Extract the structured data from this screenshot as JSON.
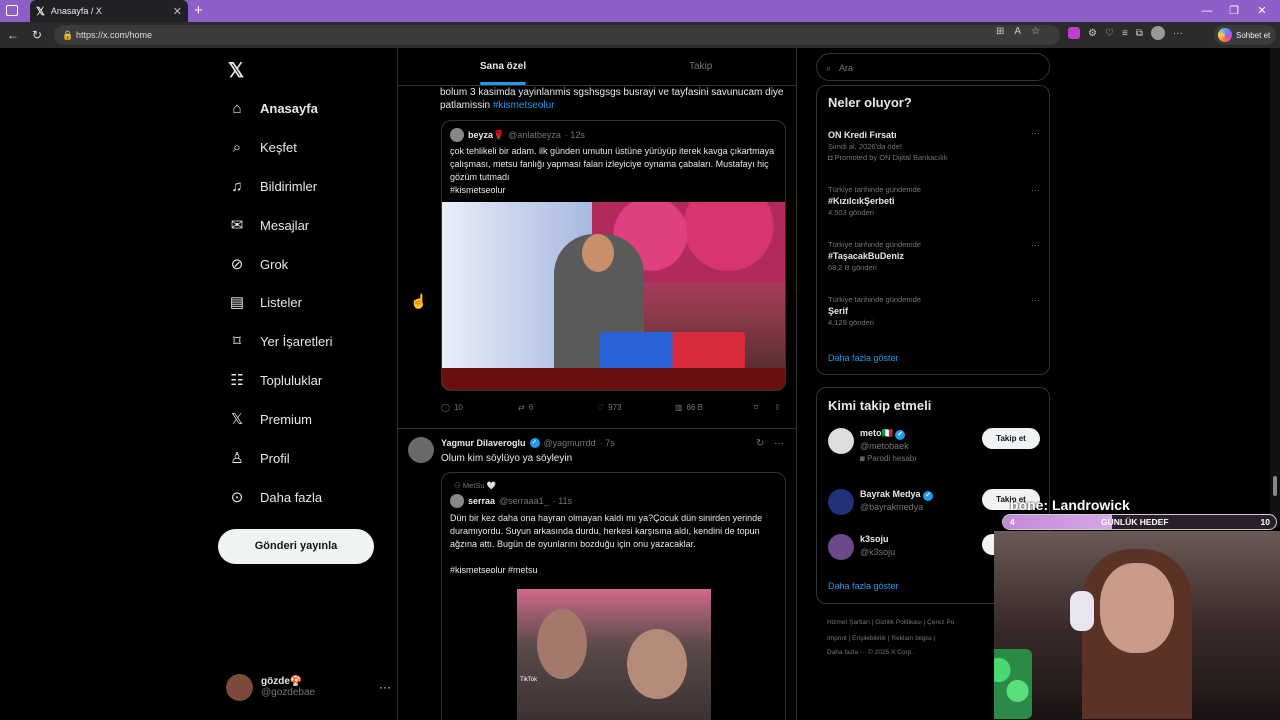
{
  "browser": {
    "tab_title": "Anasayfa / X",
    "url": "https://x.com/home",
    "copilot_label": "Sohbet et"
  },
  "sidebar": {
    "items": [
      {
        "label": "Anasayfa",
        "icon": "home-icon"
      },
      {
        "label": "Keşfet",
        "icon": "search-icon"
      },
      {
        "label": "Bildirimler",
        "icon": "bell-icon"
      },
      {
        "label": "Mesajlar",
        "icon": "mail-icon"
      },
      {
        "label": "Grok",
        "icon": "grok-icon"
      },
      {
        "label": "Listeler",
        "icon": "list-icon"
      },
      {
        "label": "Yer İşaretleri",
        "icon": "bookmark-icon"
      },
      {
        "label": "Topluluklar",
        "icon": "communities-icon"
      },
      {
        "label": "Premium",
        "icon": "x-icon"
      },
      {
        "label": "Profil",
        "icon": "person-icon"
      },
      {
        "label": "Daha fazla",
        "icon": "more-circle-icon"
      }
    ],
    "post_button": "Gönderi yayınla",
    "account": {
      "name": "gözde🍄",
      "handle": "@gozdebae"
    }
  },
  "feed": {
    "tabs": [
      "Sana özel",
      "Takip"
    ],
    "tweet1": {
      "text": "bolum 3 kasimda yayinlanmis sgshsgsgs busrayi ve tayfasini savunucam diye patlamissin",
      "hashtag": "#kismetseolur",
      "quote": {
        "name": "beyza🌹",
        "handle": "@anlatbeyza",
        "time": "· 12s",
        "text": "çok tehlikeli bir adam. ilk günden umutun üstüne yürüyüp iterek kavga çıkartmaya çalışması, metsu fanlığı yapması falan izleyiciye oynama çabaları. Mustafayı hiç gözüm tutmadı",
        "hashtag": "#kismetseolur"
      },
      "stats": {
        "replies": "10",
        "retweets": "6",
        "likes": "973",
        "views": "66 B"
      }
    },
    "tweet2": {
      "name": "Yagmur Dilaveroglu",
      "handle": "@yagmurrdd",
      "time": "· 7s",
      "text": "Olum kim söylüyo ya söyleyin",
      "quote": {
        "context": "MetSu 🤍",
        "name": "serraa",
        "handle": "@serraaa1_",
        "time": "· 11s",
        "text": "Dün bir kez daha ona hayran olmayan kaldı mı ya?Çocuk dün sinirden yerinde duramıyordu. Suyun arkasında durdu, herkesi karşısına aldı, kendini de topun ağzına attı. Bugün de oyunlarını bozduğu için onu yazacaklar.",
        "hashtags": "#kismetseolur #metsu",
        "video_badge": "TikTok"
      }
    }
  },
  "right": {
    "search_placeholder": "Ara",
    "trends_title": "Neler oluyor?",
    "trends": [
      {
        "ctx": "",
        "name": "ON Kredi Fırsatı",
        "count": "Şimdi al, 2026'da öde!",
        "promo": "Promoted by ON Dijital Bankacılık"
      },
      {
        "ctx": "Türkiye tarihinde gündemde",
        "name": "#KızılcıkŞerbeti",
        "count": "4.503 gönderi"
      },
      {
        "ctx": "Türkiye tarihinde gündemde",
        "name": "#TaşacakBuDeniz",
        "count": "68,2 B gönderi"
      },
      {
        "ctx": "Türkiye tarihinde gündemde",
        "name": "Şerif",
        "count": "4.129 gönderi"
      }
    ],
    "show_more": "Daha fazla göster",
    "who_title": "Kimi takip etmeli",
    "who": [
      {
        "name": "meto🇮🇹",
        "handle": "@metobaek",
        "sub": "Parodi hesabı",
        "button": "Takip et"
      },
      {
        "name": "Bayrak Medya",
        "handle": "@bayrakmedya",
        "sub": "",
        "button": "Takip et"
      },
      {
        "name": "k3soju",
        "handle": "@k3soju",
        "sub": "",
        "button": "Takip et"
      }
    ],
    "footer": [
      "Hizmet Şartları  |  Gizlilik Politikası  |  Çerez Po",
      "Imprint  |  Erişilebilirlik  |  Reklam bilgisi  |",
      "Daha fazla ···   © 2025 X Corp."
    ]
  },
  "overlay": {
    "name": "bone: Landrowick",
    "goal_label": "GÜNLÜK HEDEF",
    "goal_current": "4",
    "goal_max": "10",
    "goal_fraction": 0.4
  }
}
